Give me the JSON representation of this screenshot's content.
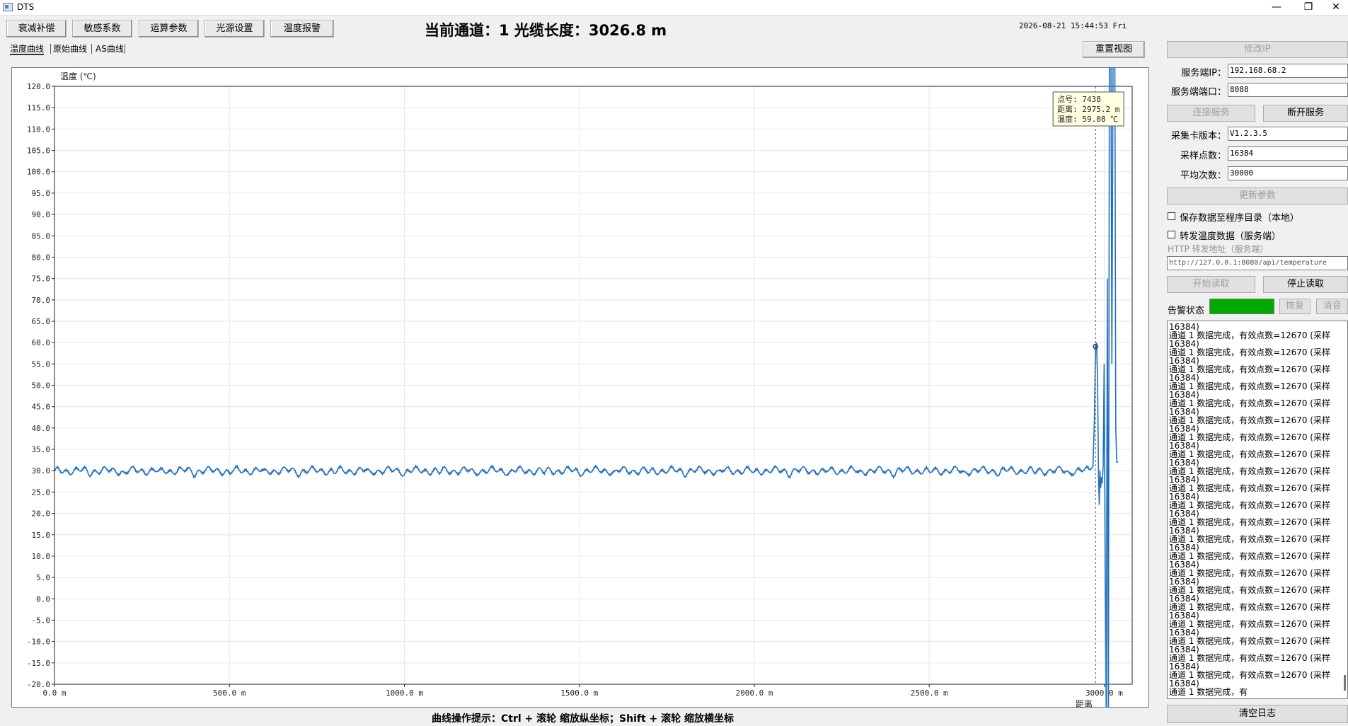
{
  "window": {
    "title": "DTS",
    "minimize": "—",
    "restore": "❐",
    "close": "✕"
  },
  "toolbar": {
    "buttons": [
      "衰减补偿",
      "敏感系数",
      "运算参数",
      "光源设置",
      "温度报警"
    ]
  },
  "header": {
    "title": "当前通道：1  光缆长度：3026.8 m",
    "datetime": "2026-08-21 15:44:53 Fri"
  },
  "tabs": [
    "温度曲线",
    "原始曲线",
    "AS曲线"
  ],
  "reset_view": "重置视图",
  "chart_data": {
    "type": "line",
    "ylabel": "温度 (℃)",
    "xlabel": "距离",
    "xlim": [
      0,
      3080
    ],
    "ylim": [
      -20,
      120
    ],
    "y_ticks": [
      -20,
      -15,
      -10,
      -5,
      0,
      5,
      10,
      15,
      20,
      25,
      30,
      35,
      40,
      45,
      50,
      55,
      60,
      65,
      70,
      75,
      80,
      85,
      90,
      95,
      100,
      105,
      110,
      115,
      120
    ],
    "x_ticks": [
      0,
      500,
      1000,
      1500,
      2000,
      2500,
      3000
    ],
    "x_tick_labels": [
      "0.0 m",
      "500.0 m",
      "1000.0 m",
      "1500.0 m",
      "2000.0 m",
      "2500.0 m",
      "3000.0 m"
    ],
    "grid": true,
    "line_color": "#1f6fbf",
    "series": [
      {
        "baseline": 30,
        "end_points": [
          [
            2960,
            30.2
          ],
          [
            2968,
            31
          ],
          [
            2972,
            42
          ],
          [
            2975.2,
            59.08
          ],
          [
            2978,
            60
          ],
          [
            2981,
            52
          ],
          [
            2984,
            28
          ],
          [
            2986,
            22
          ],
          [
            2988,
            30
          ],
          [
            2990,
            26
          ],
          [
            2992,
            28.5
          ],
          [
            2994,
            27
          ],
          [
            2997,
            31
          ],
          [
            3000,
            55
          ],
          [
            3003,
            10
          ],
          [
            3006,
            -30
          ],
          [
            3009,
            75
          ],
          [
            3012,
            -30
          ],
          [
            3015,
            140
          ],
          [
            3019,
            140
          ],
          [
            3022,
            55
          ],
          [
            3026,
            140
          ],
          [
            3030,
            140
          ],
          [
            3033,
            40
          ],
          [
            3036,
            32
          ],
          [
            3040,
            32
          ]
        ]
      }
    ],
    "tooltip": {
      "lines": [
        "点号: 7438",
        "距离: 2975.2 m",
        "温度: 59.08 ℃"
      ],
      "x": 2975.2,
      "y": 59.08
    }
  },
  "hint": "曲线操作提示：Ctrl + 滚轮 缩放纵坐标；Shift + 滚轮 缩放横坐标",
  "panel": {
    "modify_ip": "修改IP",
    "server_ip_label": "服务端IP：",
    "server_ip": "192.168.68.2",
    "server_port_label": "服务端端口：",
    "server_port": "8088",
    "connect": "连接服务",
    "disconnect": "断开服务",
    "card_version_label": "采集卡版本：",
    "card_version": "V1.2.3.5",
    "sample_points_label": "采样点数：",
    "sample_points": "16384",
    "average_label": "平均次数：",
    "average": "30000",
    "update_params": "更新参数",
    "save_local": "保存数据至程序目录（本地）",
    "forward_temp": "转发温度数据（服务端）",
    "http_label": "HTTP 转发地址（服务端）",
    "http_url": "http://127.0.0.1:8080/api/temperature",
    "start_read": "开始读取",
    "stop_read": "停止读取",
    "alarm_label": "告警状态",
    "alarm_color": "#00aa00",
    "restore": "恢复",
    "mute": "消音",
    "clear_log": "清空日志",
    "log_first": "16384)",
    "log_entry": "通道 1 数据完成，有效点数=12670 (采样",
    "log_cont": "16384)",
    "log_last": "通道 1 数据完成，有",
    "log_repeat": 21
  }
}
